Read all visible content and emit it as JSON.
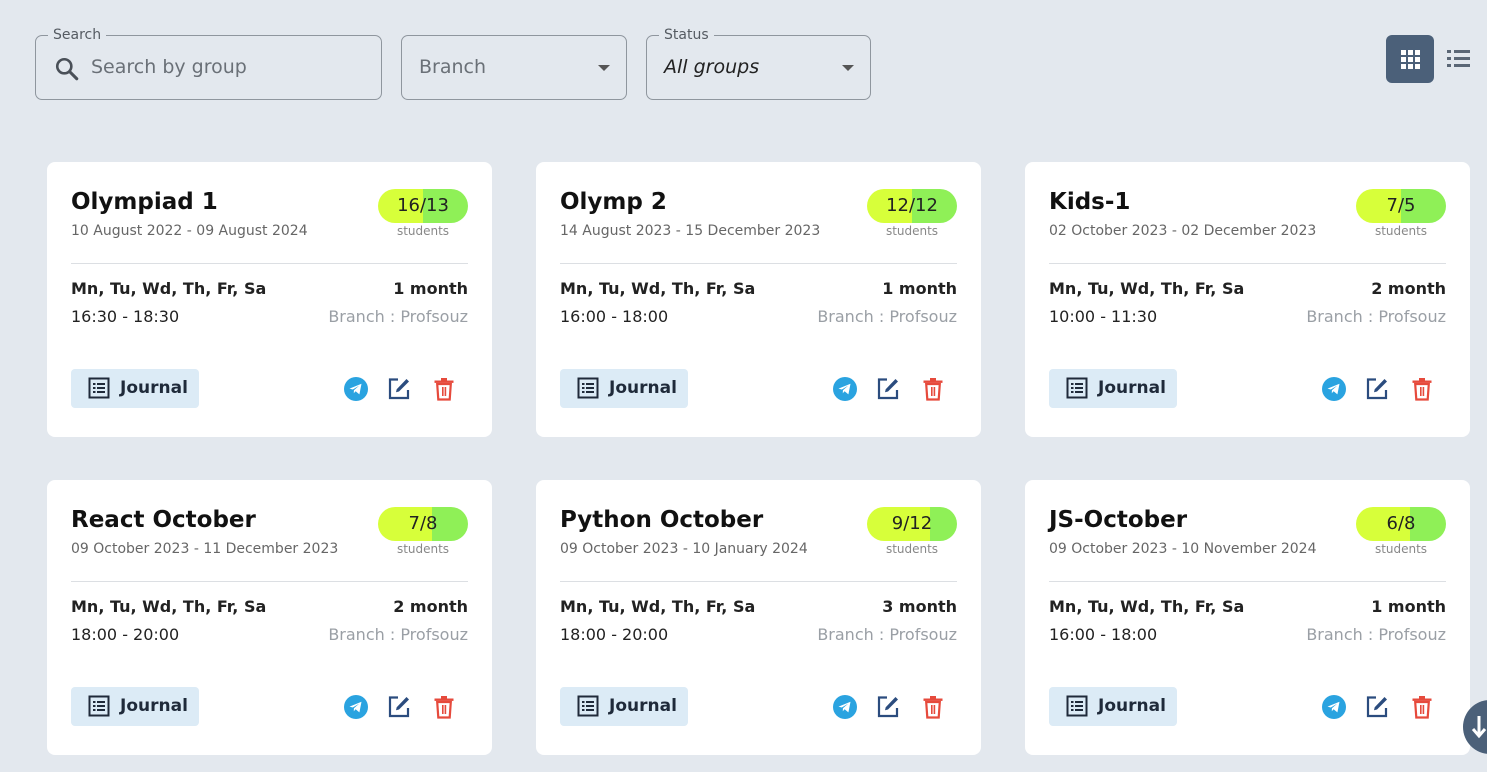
{
  "filters": {
    "search": {
      "label": "Search",
      "placeholder": "Search by group"
    },
    "branch": {
      "value": "Branch"
    },
    "status": {
      "label": "Status",
      "value": "All groups"
    }
  },
  "view_toggle": {
    "active": "grid",
    "icons": [
      "grid-icon",
      "list-icon"
    ]
  },
  "colors": {
    "background": "#e3e8ee",
    "accent": "#4b6079",
    "badge_start": "#d7ff3a",
    "badge_end": "#8ff057",
    "telegram": "#2aa3e0",
    "edit": "#2b4c7e",
    "delete": "#e64a3c",
    "journal_bg": "#dcebf6"
  },
  "groups": [
    {
      "title": "Olympiad 1",
      "dates": "10 August 2022 - 09 August 2024",
      "students": "16/13",
      "students_label": "students",
      "fill": 0.5,
      "days": "Mn, Tu, Wd, Th, Fr, Sa",
      "duration": "1 month",
      "time": "16:30 - 18:30",
      "branch": "Branch : Profsouz",
      "journal": "Journal"
    },
    {
      "title": "Olymp 2",
      "dates": "14 August 2023 - 15 December 2023",
      "students": "12/12",
      "students_label": "students",
      "fill": 0.5,
      "days": "Mn, Tu, Wd, Th, Fr, Sa",
      "duration": "1 month",
      "time": "16:00 - 18:00",
      "branch": "Branch : Profsouz",
      "journal": "Journal"
    },
    {
      "title": "Kids-1",
      "dates": "02 October 2023 - 02 December 2023",
      "students": "7/5",
      "students_label": "students",
      "fill": 0.5,
      "days": "Mn, Tu, Wd, Th, Fr, Sa",
      "duration": "2 month",
      "time": "10:00 - 11:30",
      "branch": "Branch : Profsouz",
      "journal": "Journal"
    },
    {
      "title": "React October",
      "dates": "09 October 2023 - 11 December 2023",
      "students": "7/8",
      "students_label": "students",
      "fill": 0.6,
      "days": "Mn, Tu, Wd, Th, Fr, Sa",
      "duration": "2 month",
      "time": "18:00 - 20:00",
      "branch": "Branch : Profsouz",
      "journal": "Journal"
    },
    {
      "title": "Python October",
      "dates": "09 October 2023 - 10 January 2024",
      "students": "9/12",
      "students_label": "students",
      "fill": 0.7,
      "days": "Mn, Tu, Wd, Th, Fr, Sa",
      "duration": "3 month",
      "time": "18:00 - 20:00",
      "branch": "Branch : Profsouz",
      "journal": "Journal"
    },
    {
      "title": "JS-October",
      "dates": "09 October 2023 - 10 November 2024",
      "students": "6/8",
      "students_label": "students",
      "fill": 0.6,
      "days": "Mn, Tu, Wd, Th, Fr, Sa",
      "duration": "1 month",
      "time": "16:00 - 18:00",
      "branch": "Branch : Profsouz",
      "journal": "Journal"
    }
  ]
}
